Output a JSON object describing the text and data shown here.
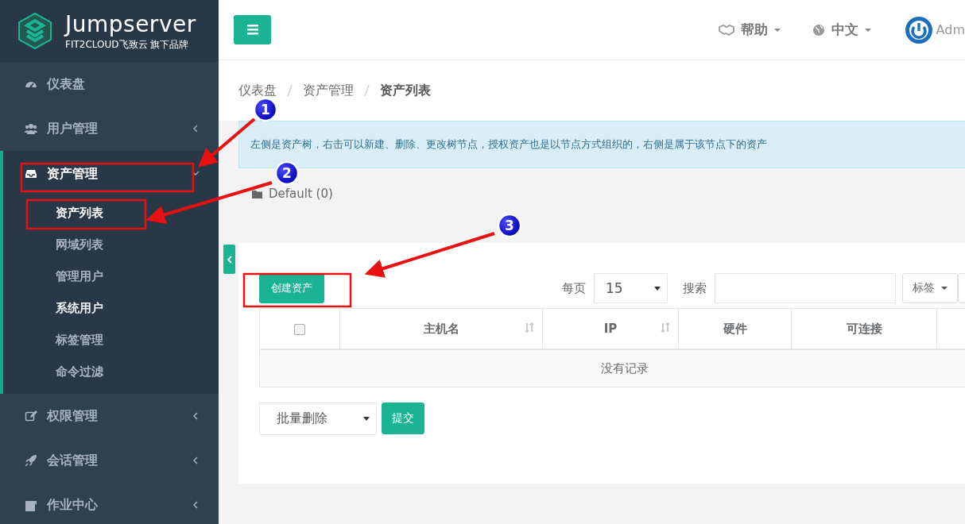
{
  "logo": {
    "title": "Jumpserver",
    "subtitle": "FIT2CLOUD飞致云 旗下品牌"
  },
  "sidebar": {
    "items": [
      {
        "label": "仪表盘",
        "has_children": false,
        "expanded": false
      },
      {
        "label": "用户管理",
        "has_children": true,
        "expanded": false
      },
      {
        "label": "资产管理",
        "has_children": true,
        "expanded": true,
        "children": [
          {
            "label": "资产列表",
            "selected": true,
            "hovered": false
          },
          {
            "label": "网域列表",
            "selected": false,
            "hovered": false
          },
          {
            "label": "管理用户",
            "selected": false,
            "hovered": false
          },
          {
            "label": "系统用户",
            "selected": false,
            "hovered": true
          },
          {
            "label": "标签管理",
            "selected": false,
            "hovered": false
          },
          {
            "label": "命令过滤",
            "selected": false,
            "hovered": false
          }
        ]
      },
      {
        "label": "权限管理",
        "has_children": true,
        "expanded": false
      },
      {
        "label": "会话管理",
        "has_children": true,
        "expanded": false
      },
      {
        "label": "作业中心",
        "has_children": true,
        "expanded": false
      }
    ]
  },
  "header": {
    "menus": [
      {
        "label": "帮助"
      },
      {
        "label": "中文"
      }
    ],
    "user": "Adm"
  },
  "breadcrumb": [
    {
      "label": "仪表盘",
      "current": false
    },
    {
      "label": "资产管理",
      "current": false
    },
    {
      "label": "资产列表",
      "current": true
    }
  ],
  "alert": "左侧是资产树，右击可以新建、删除、更改树节点，授权资产也是以节点方式组织的，右侧是属于该节点下的资产",
  "tree": [
    {
      "label": "Default (0)"
    }
  ],
  "toolbar": {
    "create_button": "创建资产",
    "page_size_label": "每页",
    "page_size": "15",
    "search_label": "搜索",
    "tag_button": "标签"
  },
  "table": {
    "columns": [
      {
        "kind": "checkbox",
        "checked": false,
        "sortable": false
      },
      {
        "label": "主机名",
        "kind": "text",
        "sortable": true
      },
      {
        "label": "IP",
        "kind": "text",
        "sortable": true
      },
      {
        "label": "硬件",
        "kind": "text",
        "sortable": false
      },
      {
        "label": "可连接",
        "kind": "text",
        "sortable": false
      },
      {
        "kind": "text",
        "sortable": false
      }
    ],
    "empty_text": "没有记录"
  },
  "bulk": {
    "action": "批量删除",
    "submit": "提交"
  },
  "annotations": [
    {
      "number": "1"
    },
    {
      "number": "2"
    },
    {
      "number": "3"
    }
  ]
}
